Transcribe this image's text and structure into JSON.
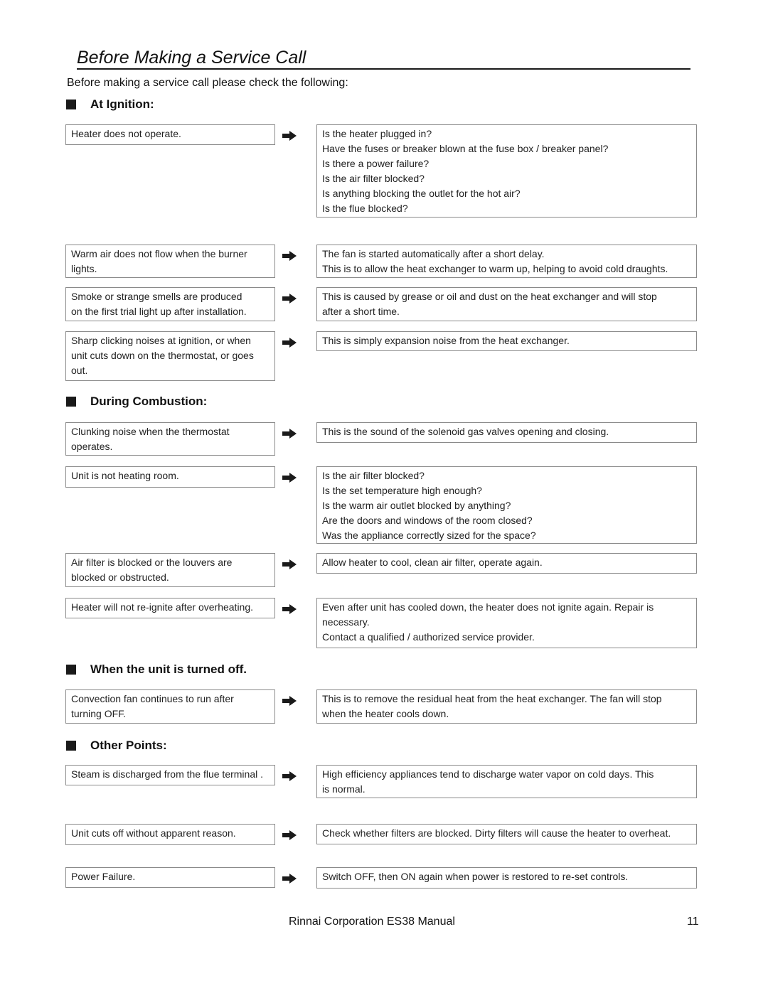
{
  "title": "Before Making a Service Call",
  "intro": "Before making a service call please check the following:",
  "sections": {
    "ignition": {
      "heading": "At Ignition:",
      "items": [
        {
          "problem": [
            "Heater does not operate."
          ],
          "solution": [
            "Is the heater plugged in?",
            "Have the fuses or breaker blown at the fuse box / breaker panel?",
            "Is there a power failure?",
            "Is the air filter blocked?",
            "Is anything blocking the outlet for the hot air?",
            "Is the flue blocked?"
          ]
        },
        {
          "problem": [
            "Warm air does not flow when the burner",
            "lights."
          ],
          "solution": [
            "The fan is started automatically after a short delay.",
            "This is to allow the heat exchanger to warm up, helping to avoid cold draughts."
          ]
        },
        {
          "problem": [
            "Smoke or strange smells are produced",
            "on the first trial light up after installation."
          ],
          "solution": [
            "This is caused by grease or oil and dust on the heat exchanger and will stop",
            "after a short time."
          ]
        },
        {
          "problem": [
            "Sharp clicking noises at ignition, or when",
            "unit cuts down on the thermostat, or goes",
            "out."
          ],
          "solution": [
            "This is simply expansion noise from the heat exchanger."
          ]
        }
      ]
    },
    "combustion": {
      "heading": "During Combustion:",
      "items": [
        {
          "problem": [
            "Clunking noise when the thermostat",
            "operates."
          ],
          "solution": [
            "This is the sound of the solenoid gas valves opening and closing."
          ]
        },
        {
          "problem": [
            "Unit is not heating room."
          ],
          "solution": [
            "Is the air filter blocked?",
            "Is the set temperature high enough?",
            "Is the warm air outlet blocked by anything?",
            "Are the doors and windows of the room closed?",
            "Was the appliance correctly sized for the space?"
          ]
        },
        {
          "problem": [
            "Air filter is blocked or the louvers are",
            "blocked or obstructed."
          ],
          "solution": [
            "Allow heater to cool, clean air filter, operate again."
          ]
        },
        {
          "problem": [
            "Heater will not re-ignite after overheating."
          ],
          "solution": [
            "Even after unit has cooled down, the heater does not ignite again.  Repair is",
            "necessary.",
            "Contact a qualified / authorized service provider."
          ]
        }
      ]
    },
    "turned_off": {
      "heading": "When the unit is turned off.",
      "items": [
        {
          "problem": [
            "Convection fan continues to run after",
            "turning OFF."
          ],
          "solution": [
            "This is to remove the residual heat from the heat exchanger.  The fan will stop",
            "when the heater cools down."
          ]
        }
      ]
    },
    "other": {
      "heading": "Other Points:",
      "items": [
        {
          "problem": [
            "Steam is discharged from the flue terminal ."
          ],
          "solution": [
            "High efficiency appliances tend to discharge water vapor on cold days.  This",
            "is normal."
          ]
        },
        {
          "problem": [
            "Unit cuts off without apparent reason."
          ],
          "solution": [
            "Check whether filters are blocked.  Dirty filters will cause the heater to overheat."
          ]
        },
        {
          "problem": [
            "Power Failure."
          ],
          "solution": [
            "Switch OFF, then ON again when power is restored to re-set controls."
          ]
        }
      ]
    }
  },
  "footer": {
    "text": "Rinnai Corporation ES38 Manual",
    "page_number": "11"
  }
}
